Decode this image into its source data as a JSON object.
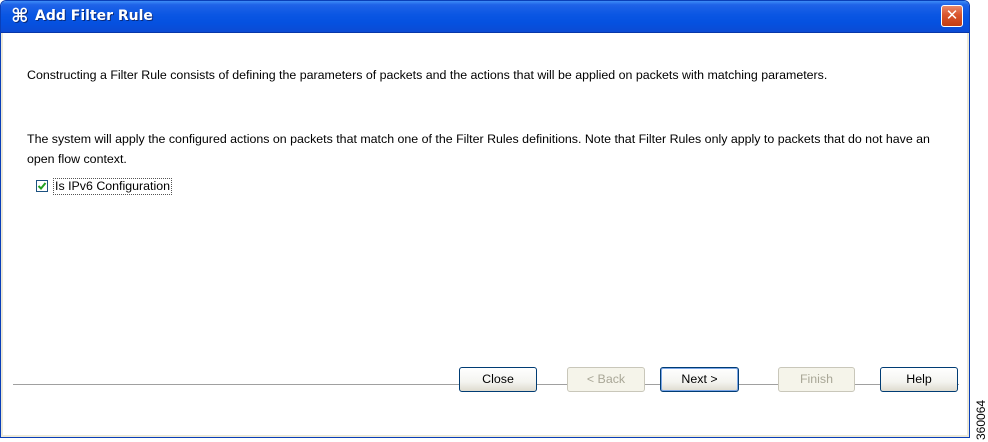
{
  "window": {
    "title": "Add Filter Rule",
    "title_icon": "cisco-app-icon",
    "close_glyph": "✕"
  },
  "content": {
    "paragraph_1": "Constructing a Filter Rule consists of defining the parameters of packets and the actions that will be applied on packets with matching parameters.",
    "paragraph_2": "The system will apply the configured actions on packets that match one of the Filter Rules definitions. Note that Filter Rules only apply to packets that do not have an open flow context.",
    "ipv6_checkbox": {
      "label": "Is IPv6 Configuration",
      "checked": true
    }
  },
  "buttons": {
    "close": "Close",
    "back": "< Back",
    "next": "Next >",
    "finish": "Finish",
    "help": "Help"
  },
  "figure_id": "360064",
  "colors": {
    "titlebar": "#0a56e3",
    "dialog_frame": "#ece9d8",
    "close_button": "#d9542c",
    "checkmark": "#21a121"
  }
}
